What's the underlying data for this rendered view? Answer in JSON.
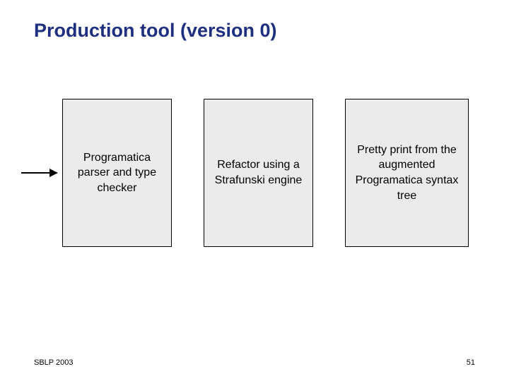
{
  "title": "Production tool (version 0)",
  "boxes": {
    "b1": "Programatica parser and type checker",
    "b2": "Refactor using a Strafunski engine",
    "b3": "Pretty print from the augmented Programatica syntax tree"
  },
  "footer": {
    "left": "SBLP 2003",
    "right": "51"
  },
  "colors": {
    "title": "#1f2f7f",
    "box_bg": "#ebebeb"
  }
}
